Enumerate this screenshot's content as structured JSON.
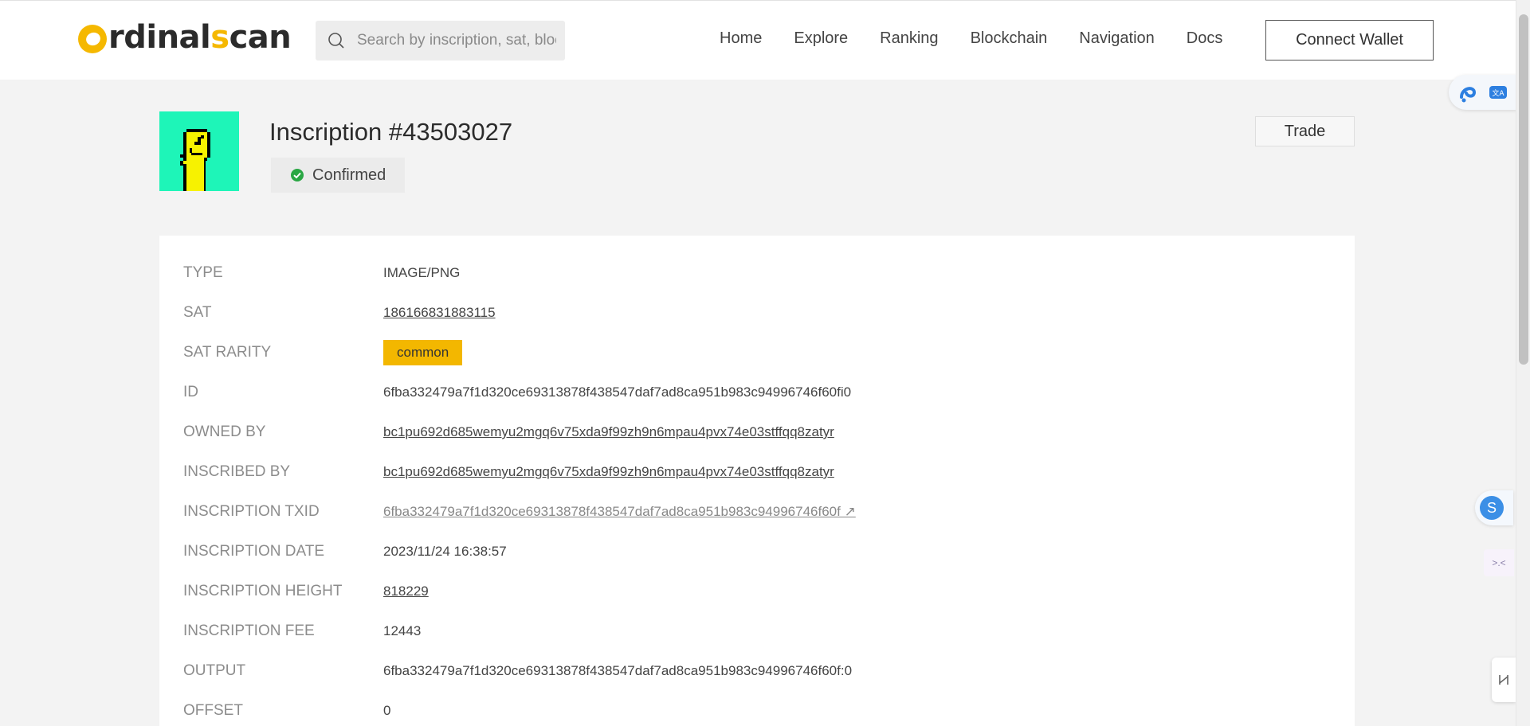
{
  "header": {
    "logo": {
      "prefix": "rdinal",
      "s": "s",
      "suffix": "can",
      "accent_color": "#f5b800"
    },
    "search": {
      "placeholder": "Search by inscription, sat, block"
    },
    "nav": [
      "Home",
      "Explore",
      "Ranking",
      "Blockchain",
      "Navigation",
      "Docs"
    ],
    "connect_wallet_label": "Connect Wallet"
  },
  "inscription": {
    "title": "Inscription #43503027",
    "status": "Confirmed",
    "status_color": "#2aa744",
    "trade_label": "Trade"
  },
  "details": [
    {
      "label": "TYPE",
      "value": "IMAGE/PNG",
      "style": "plain"
    },
    {
      "label": "SAT",
      "value": "186166831883115",
      "style": "link"
    },
    {
      "label": "SAT RARITY",
      "value": "common",
      "style": "badge"
    },
    {
      "label": "ID",
      "value": "6fba332479a7f1d320ce69313878f438547daf7ad8ca951b983c94996746f60fi0",
      "style": "plain"
    },
    {
      "label": "OWNED BY",
      "value": "bc1pu692d685wemyu2mgq6v75xda9f99zh9n6mpau4pvx74e03stffqq8zatyr",
      "style": "link"
    },
    {
      "label": "INSCRIBED BY",
      "value": "bc1pu692d685wemyu2mgq6v75xda9f99zh9n6mpau4pvx74e03stffqq8zatyr",
      "style": "link"
    },
    {
      "label": "INSCRIPTION TXID",
      "value": "6fba332479a7f1d320ce69313878f438547daf7ad8ca951b983c94996746f60f ↗",
      "style": "muted-link"
    },
    {
      "label": "INSCRIPTION DATE",
      "value": "2023/11/24 16:38:57",
      "style": "plain"
    },
    {
      "label": "INSCRIPTION HEIGHT",
      "value": "818229",
      "style": "link"
    },
    {
      "label": "INSCRIPTION FEE",
      "value": "12443",
      "style": "plain"
    },
    {
      "label": "OUTPUT",
      "value": "6fba332479a7f1d320ce69313878f438547daf7ad8ca951b983c94996746f60f:0",
      "style": "plain"
    },
    {
      "label": "OFFSET",
      "value": "0",
      "style": "plain"
    }
  ],
  "widgets": {
    "s_label": "S",
    "code_label": ">.<",
    "rarity_color": "#f3b700",
    "thumb_bg": "#1ef5b8"
  }
}
